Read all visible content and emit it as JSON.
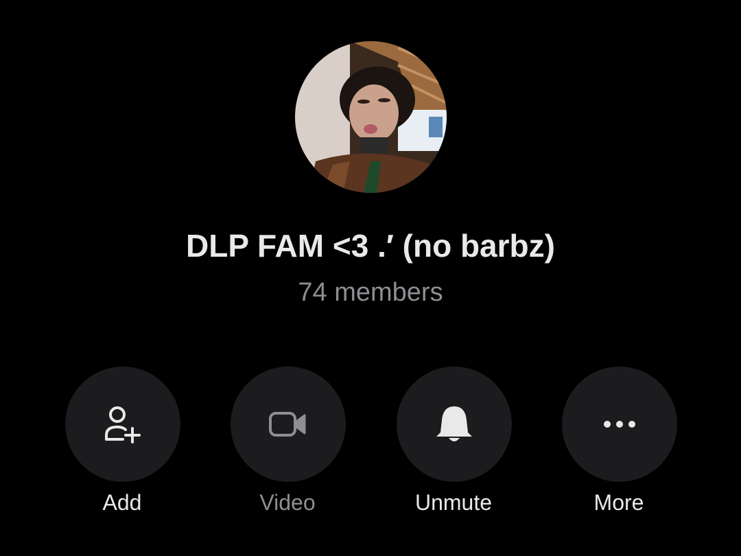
{
  "group": {
    "name": "DLP FAM <3 .′ (no barbz)",
    "members": "74 members",
    "avatar_icon": "group-photo"
  },
  "actions": [
    {
      "label": "Add",
      "icon": "add-person-icon",
      "enabled": true
    },
    {
      "label": "Video",
      "icon": "video-camera-icon",
      "enabled": false
    },
    {
      "label": "Unmute",
      "icon": "bell-icon",
      "enabled": true
    },
    {
      "label": "More",
      "icon": "more-dots-icon",
      "enabled": true
    }
  ],
  "colors": {
    "background": "#000000",
    "button_bg": "#1c1c1e",
    "primary_text": "#e9e9e9",
    "secondary_text": "#8e8e93"
  }
}
